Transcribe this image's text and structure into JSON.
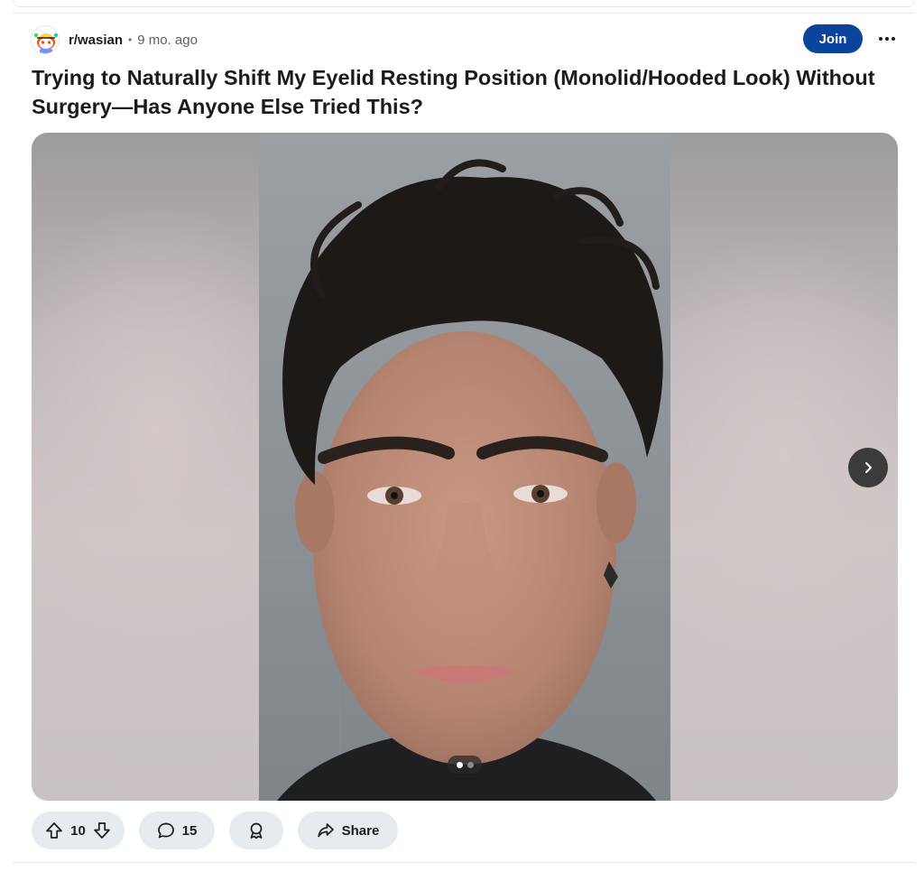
{
  "post": {
    "subreddit": "r/wasian",
    "separator": "•",
    "age": "9 mo. ago",
    "join_label": "Join",
    "more_label": "•••",
    "title": "Trying to Naturally Shift My Eyelid Resting Position (Monolid/Hooded Look) Without Surgery—Has Anyone Else Tried This?",
    "media": {
      "page_count": 2,
      "current_page": 1,
      "next_icon": "chevron-right-icon"
    },
    "actions": {
      "upvotes": "10",
      "comments": "15",
      "share_label": "Share"
    }
  },
  "colors": {
    "join_button": "#0a449b",
    "action_pill": "#e5ebee",
    "title_text": "#181c1f",
    "meta_text": "#5c6166"
  }
}
